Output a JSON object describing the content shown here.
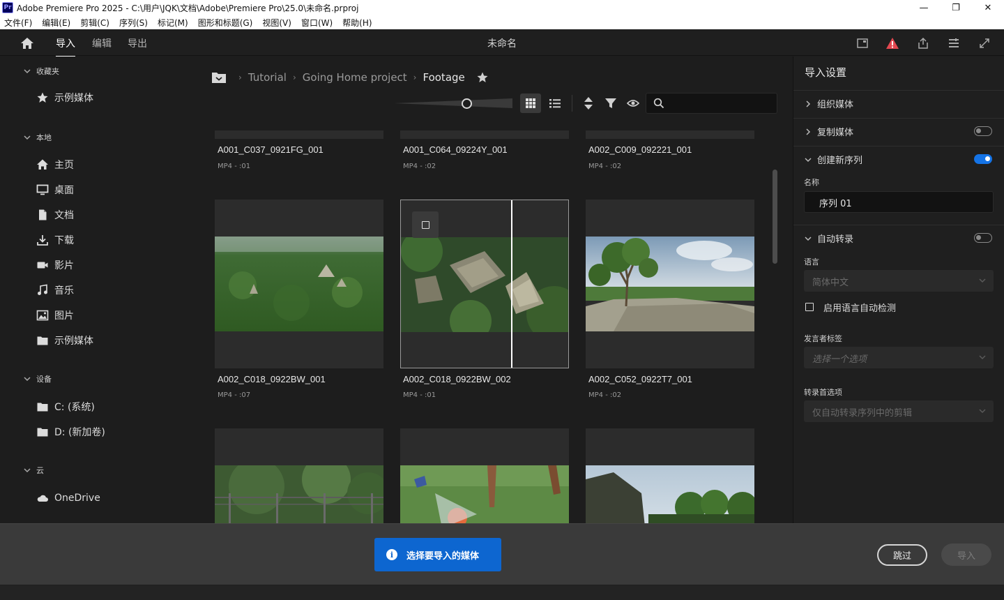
{
  "window": {
    "title": "Adobe Premiere Pro 2025 - C:\\用户\\JQK\\文档\\Adobe\\Premiere Pro\\25.0\\未命名.prproj",
    "app_icon": "Pr",
    "controls": {
      "minimize": "—",
      "restore": "❐",
      "close": "✕"
    }
  },
  "menu": [
    "文件(F)",
    "编辑(E)",
    "剪辑(C)",
    "序列(S)",
    "标记(M)",
    "图形和标题(G)",
    "视图(V)",
    "窗口(W)",
    "帮助(H)"
  ],
  "header": {
    "tabs": [
      "导入",
      "编辑",
      "导出"
    ],
    "active_tab": "导入",
    "document_title": "未命名",
    "icons": [
      "home-icon",
      "quick-export-icon",
      "warning-icon",
      "share-icon",
      "workspaces-icon",
      "fullscreen-icon"
    ],
    "warning_color": "#e34850"
  },
  "sidebar": {
    "favorites": {
      "header": "收藏夹",
      "items": [
        {
          "label": "示例媒体",
          "icon": "star-icon"
        }
      ]
    },
    "local": {
      "header": "本地",
      "items": [
        {
          "label": "主页",
          "icon": "home-icon"
        },
        {
          "label": "桌面",
          "icon": "desktop-icon"
        },
        {
          "label": "文档",
          "icon": "document-icon"
        },
        {
          "label": "下载",
          "icon": "download-icon"
        },
        {
          "label": "影片",
          "icon": "video-icon"
        },
        {
          "label": "音乐",
          "icon": "music-icon"
        },
        {
          "label": "图片",
          "icon": "image-icon"
        },
        {
          "label": "示例媒体",
          "icon": "folder-icon"
        }
      ]
    },
    "devices": {
      "header": "设备",
      "items": [
        {
          "label": "C: (系统)",
          "icon": "folder-icon"
        },
        {
          "label": "D: (新加卷)",
          "icon": "folder-icon"
        }
      ]
    },
    "cloud": {
      "header": "云",
      "items": [
        {
          "label": "OneDrive",
          "icon": "cloud-icon"
        }
      ]
    }
  },
  "browser": {
    "breadcrumb": [
      "Tutorial",
      "Going Home project",
      "Footage"
    ],
    "search": {
      "placeholder": "",
      "value": ""
    },
    "zoom_level": 0.62,
    "view_mode": "grid",
    "top_row": [
      {
        "name": "A001_C037_0921FG_001",
        "meta": "MP4 - :01"
      },
      {
        "name": "A001_C064_09224Y_001",
        "meta": "MP4 - :02"
      },
      {
        "name": "A002_C009_092221_001",
        "meta": "MP4 - :02"
      }
    ],
    "middle_row": [
      {
        "name": "A002_C018_0922BW_001",
        "meta": "MP4 - :07",
        "scene": "aerial jungle forest with ruins"
      },
      {
        "name": "A002_C018_0922BW_002",
        "meta": "MP4 - :01",
        "scene": "aerial view of Tikal temples"
      },
      {
        "name": "A002_C052_0922T7_001",
        "meta": "MP4 - :02",
        "scene": "tree on rock overlooking forest"
      }
    ],
    "bottom_row": [
      {
        "scene": "fence in forest"
      },
      {
        "scene": "feet kicking ball on grass"
      },
      {
        "scene": "temple with trees and sky"
      }
    ]
  },
  "import_settings": {
    "title": "导入设置",
    "organize_media": "组织媒体",
    "copy_media": {
      "label": "复制媒体",
      "on": false
    },
    "new_sequence": {
      "label": "创建新序列",
      "on": true,
      "name_label": "名称",
      "name_value": "序列 01"
    },
    "auto_transcribe": {
      "label": "自动转录",
      "on": false,
      "language_label": "语言",
      "language_value": "简体中文",
      "auto_detect_label": "启用语言自动检测",
      "speaker_label": "发言者标签",
      "speaker_placeholder": "选择一个选项",
      "pref_label": "转录首选项",
      "pref_value": "仅自动转录序列中的剪辑"
    }
  },
  "footer": {
    "toast": "选择要导入的媒体",
    "toast_icon": "info-icon",
    "skip": "跳过",
    "import": "导入",
    "accent": "#0d66d0"
  }
}
